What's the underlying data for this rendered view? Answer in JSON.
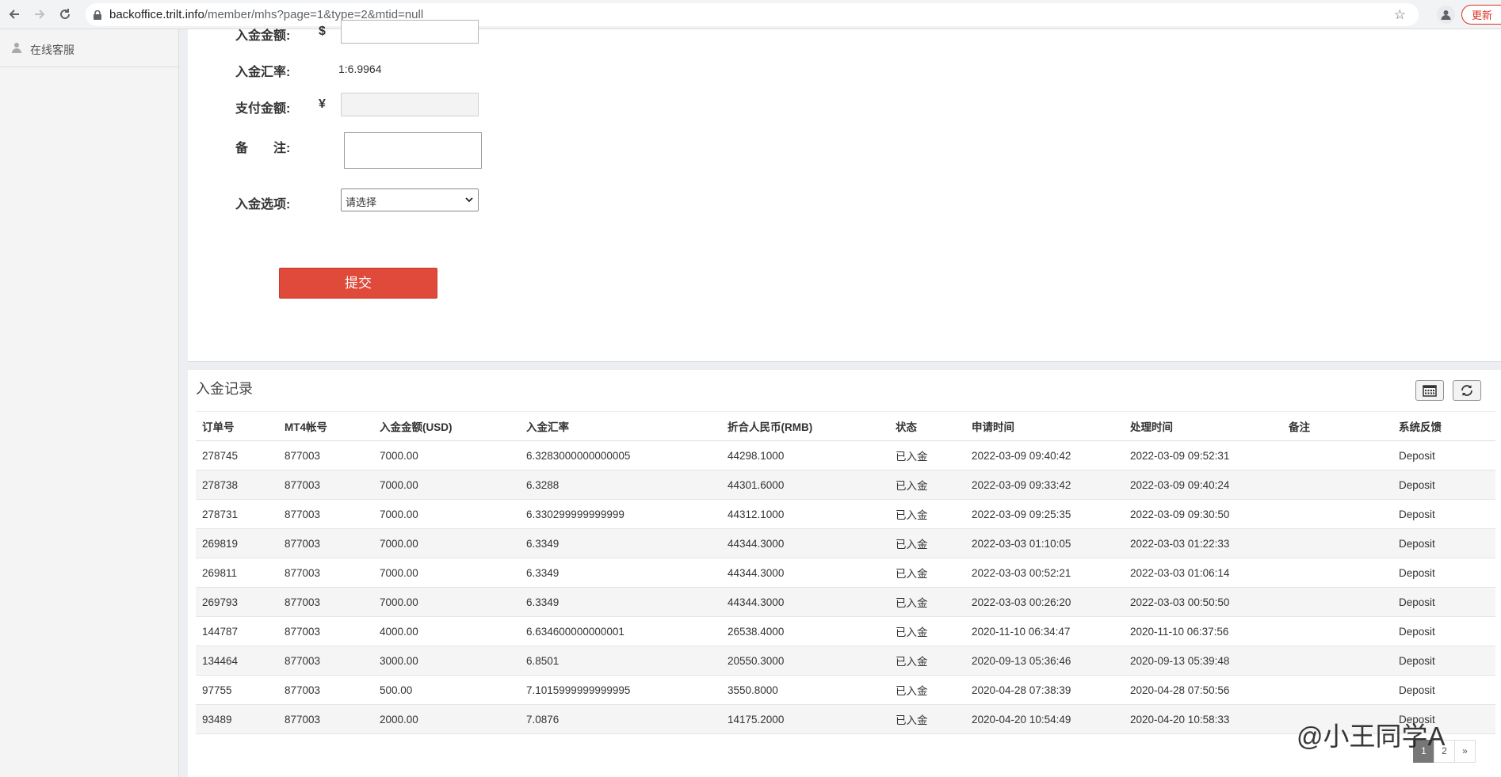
{
  "browser": {
    "url_domain": "backoffice.trilt.info",
    "url_path": "/member/mhs?page=1&type=2&mtid=null",
    "update_label": "更新"
  },
  "sidebar": {
    "items": [
      {
        "label": "在线客服",
        "icon": "user-icon"
      }
    ]
  },
  "form": {
    "amount_label": "入金金额:",
    "amount_currency": "$",
    "rate_label": "入金汇率:",
    "rate_value": "1:6.9964",
    "pay_label": "支付金额:",
    "pay_currency": "¥",
    "remark_label": "备　　注:",
    "option_label": "入金选项:",
    "option_value": "请选择",
    "submit_label": "提交"
  },
  "records": {
    "title": "入金记录",
    "columns": [
      "订单号",
      "MT4帐号",
      "入金金额(USD)",
      "入金汇率",
      "折合人民币(RMB)",
      "状态",
      "申请时间",
      "处理时间",
      "备注",
      "系统反馈"
    ],
    "rows": [
      [
        "278745",
        "877003",
        "7000.00",
        "6.3283000000000005",
        "44298.1000",
        "已入金",
        "2022-03-09 09:40:42",
        "2022-03-09 09:52:31",
        "",
        "Deposit"
      ],
      [
        "278738",
        "877003",
        "7000.00",
        "6.3288",
        "44301.6000",
        "已入金",
        "2022-03-09 09:33:42",
        "2022-03-09 09:40:24",
        "",
        "Deposit"
      ],
      [
        "278731",
        "877003",
        "7000.00",
        "6.330299999999999",
        "44312.1000",
        "已入金",
        "2022-03-09 09:25:35",
        "2022-03-09 09:30:50",
        "",
        "Deposit"
      ],
      [
        "269819",
        "877003",
        "7000.00",
        "6.3349",
        "44344.3000",
        "已入金",
        "2022-03-03 01:10:05",
        "2022-03-03 01:22:33",
        "",
        "Deposit"
      ],
      [
        "269811",
        "877003",
        "7000.00",
        "6.3349",
        "44344.3000",
        "已入金",
        "2022-03-03 00:52:21",
        "2022-03-03 01:06:14",
        "",
        "Deposit"
      ],
      [
        "269793",
        "877003",
        "7000.00",
        "6.3349",
        "44344.3000",
        "已入金",
        "2022-03-03 00:26:20",
        "2022-03-03 00:50:50",
        "",
        "Deposit"
      ],
      [
        "144787",
        "877003",
        "4000.00",
        "6.634600000000001",
        "26538.4000",
        "已入金",
        "2020-11-10 06:34:47",
        "2020-11-10 06:37:56",
        "",
        "Deposit"
      ],
      [
        "134464",
        "877003",
        "3000.00",
        "6.8501",
        "20550.3000",
        "已入金",
        "2020-09-13 05:36:46",
        "2020-09-13 05:39:48",
        "",
        "Deposit"
      ],
      [
        "97755",
        "877003",
        "500.00",
        "7.1015999999999995",
        "3550.8000",
        "已入金",
        "2020-04-28 07:38:39",
        "2020-04-28 07:50:56",
        "",
        "Deposit"
      ],
      [
        "93489",
        "877003",
        "2000.00",
        "7.0876",
        "14175.2000",
        "已入金",
        "2020-04-20 10:54:49",
        "2020-04-20 10:58:33",
        "",
        "Deposit"
      ]
    ],
    "pagination": [
      "1",
      "2",
      "»"
    ],
    "current_page": "1"
  },
  "watermark": "@小王同学A"
}
